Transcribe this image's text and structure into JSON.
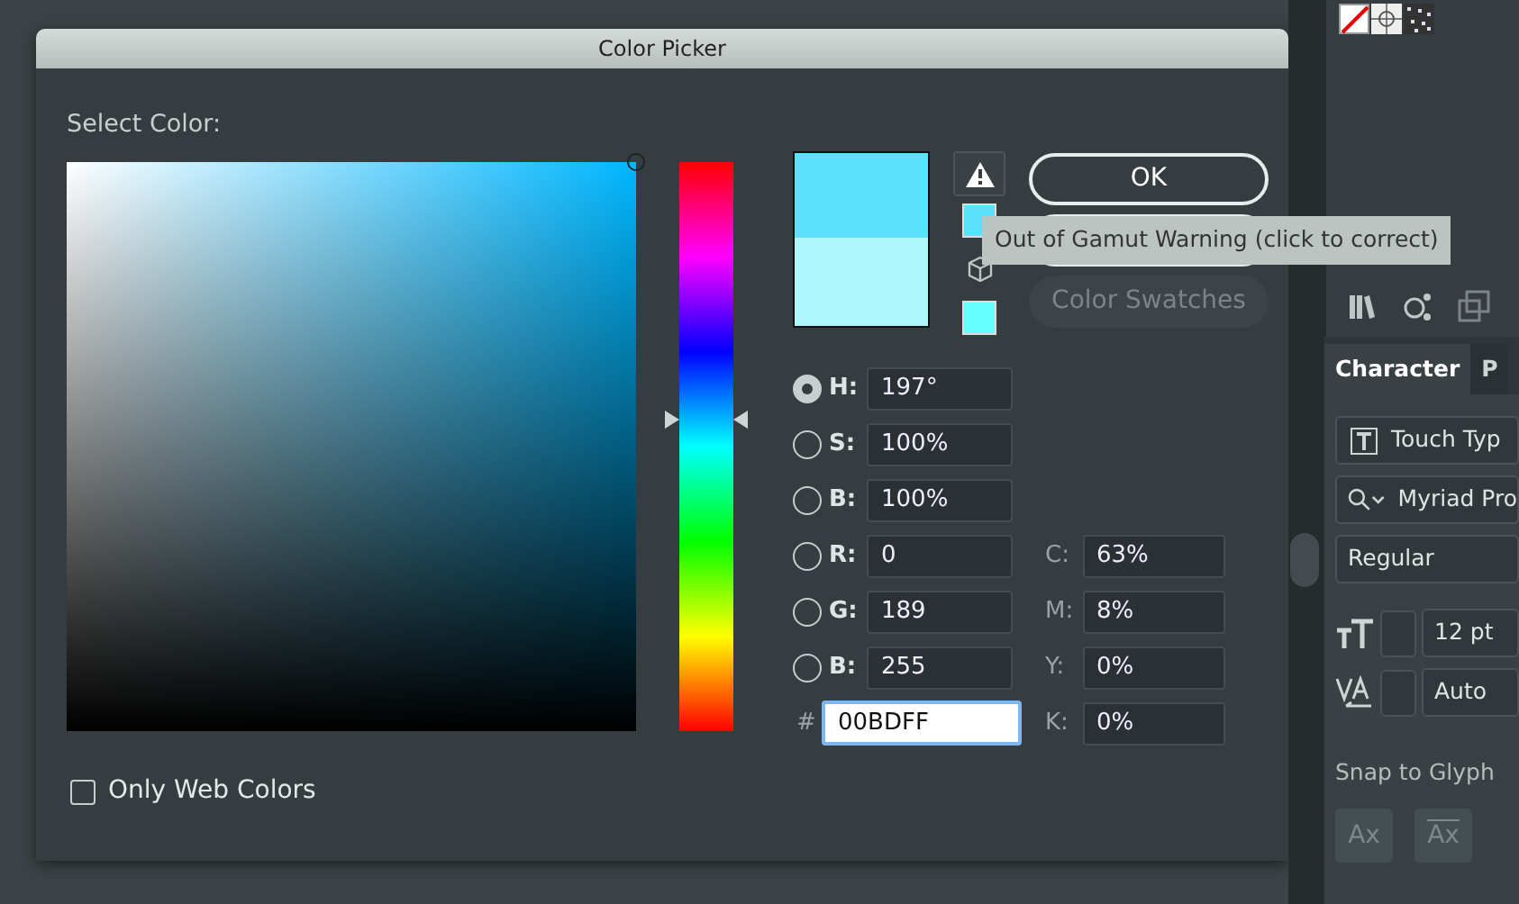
{
  "dialog": {
    "title": "Color Picker",
    "heading": "Select Color:",
    "hue": {
      "level": 0.547
    },
    "preview": [
      {
        "kind": "new",
        "color": "#5ce1fb"
      },
      {
        "kind": "current",
        "color": "#aef7fd"
      }
    ],
    "gamut_swatch": {
      "color": "#5ce1fb"
    },
    "web_swatch": {
      "color": "#66ffff"
    },
    "buttons": [
      {
        "label": "OK",
        "disabled": false
      },
      {
        "disabled": false
      },
      {
        "label": "Color Swatches",
        "disabled": true
      }
    ],
    "tooltip": "Out of Gamut Warning (click to correct)",
    "hsb_rgb": [
      {
        "label": "H:",
        "value": "197°",
        "selected": true
      },
      {
        "label": "S:",
        "value": "100%",
        "selected": false
      },
      {
        "label": "B:",
        "value": "100%",
        "selected": false
      },
      {
        "label": "R:",
        "value": "0",
        "selected": false
      },
      {
        "label": "G:",
        "value": "189",
        "selected": false
      },
      {
        "label": "B:",
        "value": "255",
        "selected": false
      }
    ],
    "hex": {
      "label": "#",
      "value": "00BDFF"
    },
    "cmyk": [
      {
        "label": "C:",
        "value": "63%"
      },
      {
        "label": "M:",
        "value": "8%"
      },
      {
        "label": "Y:",
        "value": "0%"
      },
      {
        "label": "K:",
        "value": "0%"
      }
    ],
    "only_web_colors": {
      "label": "Only Web Colors",
      "checked": false
    }
  },
  "panel": {
    "tabs": [
      {
        "label": "Character",
        "selected": true
      },
      {
        "label": "P",
        "selected": false
      }
    ],
    "touch_type": "Touch Typ",
    "font": "Myriad Pro",
    "style": "Regular",
    "size": "12 pt",
    "tracking": "Auto",
    "snap_label": "Snap to Glyph",
    "snap_buttons": [
      "Ax",
      "Ax"
    ]
  }
}
